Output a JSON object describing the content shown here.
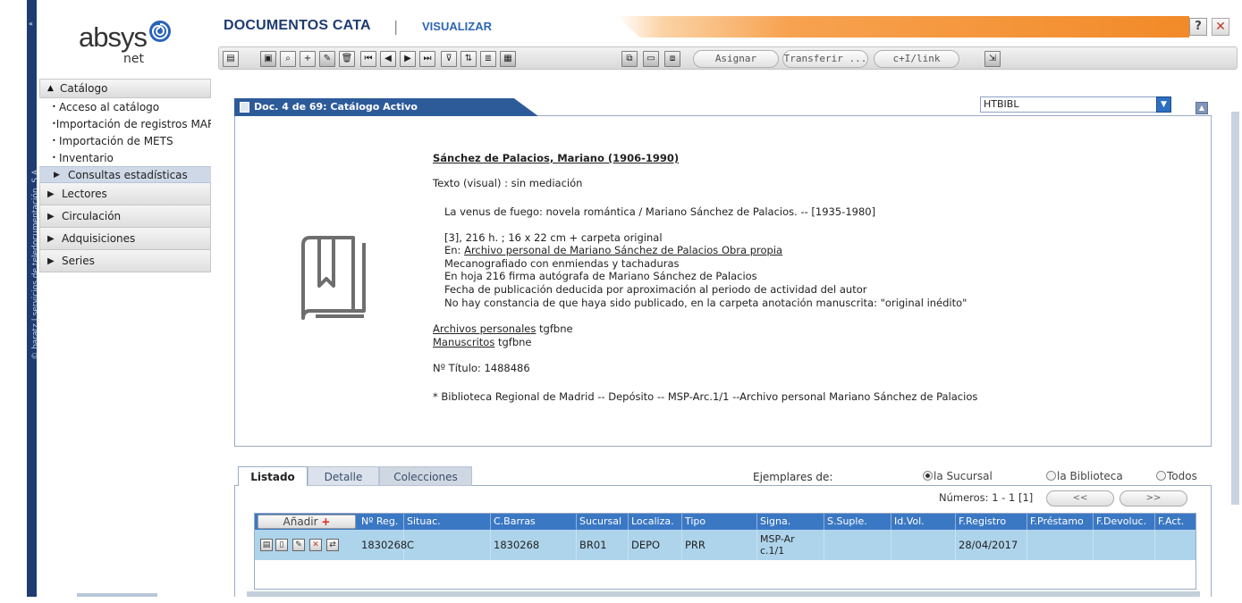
{
  "window": {
    "title": "DOCUMENTOS CATA",
    "separator": "|",
    "subtitle": "VISUALIZAR",
    "help_label": "?",
    "close_label": "✕"
  },
  "logo": {
    "name": "absys",
    "suffix": "net"
  },
  "vertical_strip": {
    "text": "© baratz | servicios de teledocumentación, S.A.",
    "mark": "«"
  },
  "sidebar": {
    "catalog_header": "Catálogo",
    "catalog_items": [
      "Acceso al catálogo",
      "Importación de registros MARC",
      "Importación de METS",
      "Inventario"
    ],
    "active_item": "Consultas estadísticas",
    "groups": [
      "Lectores",
      "Circulación",
      "Adquisiciones",
      "Series"
    ]
  },
  "toolbar": {
    "buttons": [
      {
        "icon": "menu-icon",
        "glyph": "▤"
      },
      {
        "icon": "screen-icon",
        "glyph": "▣"
      },
      {
        "icon": "search-icon",
        "glyph": "⌕"
      },
      {
        "icon": "add-icon",
        "glyph": "+"
      },
      {
        "icon": "edit-icon",
        "glyph": "✎"
      },
      {
        "icon": "delete-icon",
        "glyph": "🗑"
      },
      {
        "icon": "first-icon",
        "glyph": "⏮"
      },
      {
        "icon": "prev-icon",
        "glyph": "◀"
      },
      {
        "icon": "next-icon",
        "glyph": "▶"
      },
      {
        "icon": "last-icon",
        "glyph": "⏭"
      },
      {
        "icon": "filter-icon",
        "glyph": "⊽"
      },
      {
        "icon": "sort-icon",
        "glyph": "⇅"
      },
      {
        "icon": "list-icon",
        "glyph": "≣"
      },
      {
        "icon": "document-icon",
        "glyph": "▦"
      },
      {
        "icon": "copy-icon",
        "glyph": "⧉"
      },
      {
        "icon": "paste-icon",
        "glyph": "▭"
      },
      {
        "icon": "duplicate-icon",
        "glyph": "⧈"
      },
      {
        "icon": "export-icon",
        "glyph": "⇲"
      }
    ],
    "asignar": "Asignar",
    "transferir": "Transferir ...",
    "link": "c+I/link"
  },
  "document": {
    "tab_title": "Doc. 4 de 69: Catálogo Activo",
    "format_select": "HTBIBL",
    "record": {
      "author": "Sánchez de Palacios, Mariano (1906-1990)",
      "content_type": "Texto (visual) : sin mediación",
      "title_line": "La venus de fuego: novela romántica / Mariano Sánchez de Palacios. -- [1935-1980]",
      "extent": "[3], 216 h. ; 16 x 22 cm + carpeta original",
      "en_prefix": "En: ",
      "en_link": "Archivo personal de Mariano Sánchez de Palacios Obra propia",
      "note1": "Mecanografiado con enmiendas y tachaduras",
      "note2": "En hoja 216 firma autógrafa de Mariano Sánchez de Palacios",
      "note3": "Fecha de publicación deducida por aproximación al periodo de actividad del autor",
      "note4": "No hay constancia de que haya sido publicado, en la carpeta anotación manuscrita: \"original inédito\"",
      "subject1_link": "Archivos personales",
      "subject1_suffix": " tgfbne",
      "subject2_link": "Manuscritos",
      "subject2_suffix": " tgfbne",
      "title_number": "Nº Título: 1488486",
      "holding": "* Biblioteca Regional de Madrid -- Depósito -- MSP-Arc.1/1 --Archivo personal Mariano Sánchez de Palacios"
    }
  },
  "lower": {
    "tabs": [
      "Listado",
      "Detalle",
      "Colecciones"
    ],
    "ejemplares_label": "Ejemplares de:",
    "radios": [
      {
        "label": "la Sucursal",
        "selected": true
      },
      {
        "label": "la Biblioteca",
        "selected": false
      },
      {
        "label": "Todos",
        "selected": false
      }
    ],
    "numeros": "Números: 1 - 1 [1]",
    "prev_label": "<<",
    "next_label": ">>",
    "add_label": "Añadir",
    "add_plus": "+",
    "columns": [
      "Nº Reg.",
      "Situac.",
      "C.Barras",
      "Sucursal",
      "Localiza.",
      "Tipo",
      "Signa.",
      "S.Suple.",
      "Id.Vol.",
      "F.Registro",
      "F.Préstamo",
      "F.Devoluc.",
      "F.Act."
    ],
    "rows": [
      {
        "icons": [
          "print-icon",
          "document-icon",
          "edit-icon",
          "delete-icon",
          "transfer-icon"
        ],
        "reg": "1830268",
        "situac": "C",
        "barras": "1830268",
        "sucursal": "BR01",
        "localiza": "DEPO",
        "tipo": "PRR",
        "signa_1": "MSP-Ar",
        "signa_2": "c.1/1",
        "s_suple": "",
        "id_vol": "",
        "f_registro": "28/04/2017",
        "f_prestamo": "",
        "f_devoluc": "",
        "f_act": ""
      }
    ]
  },
  "colors": {
    "navy": "#1e3c72",
    "accent_blue": "#2d5b9a",
    "grid_header": "#3b78c4",
    "row_selected": "#aed4ec",
    "orange": "#f28a28"
  }
}
